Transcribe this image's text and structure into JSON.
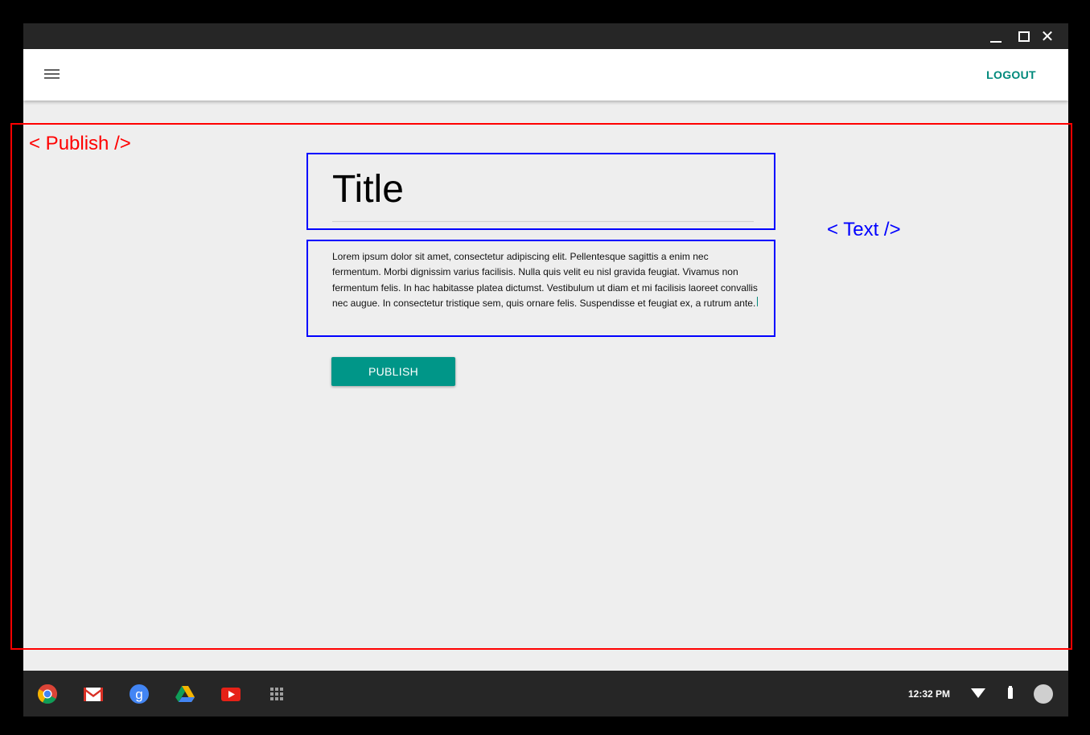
{
  "window": {
    "controls": {
      "minimize_icon": "minimize-icon",
      "maximize_icon": "maximize-icon",
      "close_icon": "close-icon",
      "close_glyph": "✕"
    }
  },
  "appbar": {
    "menu_icon": "hamburger-menu-icon",
    "logout_label": "LOGOUT",
    "accent_color": "#00897b"
  },
  "annotations": {
    "publish_label": "< Publish />",
    "text_label": "< Text />",
    "publish_color": "#ff0000",
    "text_color": "#0000ff"
  },
  "editor": {
    "title": "Title",
    "body": "Lorem ipsum dolor sit amet, consectetur adipiscing elit. Pellentesque sagittis a enim nec fermentum. Morbi dignissim varius facilisis. Nulla quis velit eu nisl gravida feugiat. Vivamus non fermentum felis. In hac habitasse platea dictumst. Vestibulum ut diam et mi facilisis laoreet convallis nec augue. In consectetur tristique sem, quis ornare felis. Suspendisse et feugiat ex, a rutrum ante.",
    "publish_label": "PUBLISH",
    "button_color": "#009688"
  },
  "shelf": {
    "apps": [
      "chrome-icon",
      "gmail-icon",
      "google-search-icon",
      "drive-icon",
      "youtube-icon",
      "app-launcher-icon"
    ],
    "time": "12:32 PM",
    "status_icons": [
      "wifi-icon",
      "battery-icon",
      "avatar"
    ]
  }
}
